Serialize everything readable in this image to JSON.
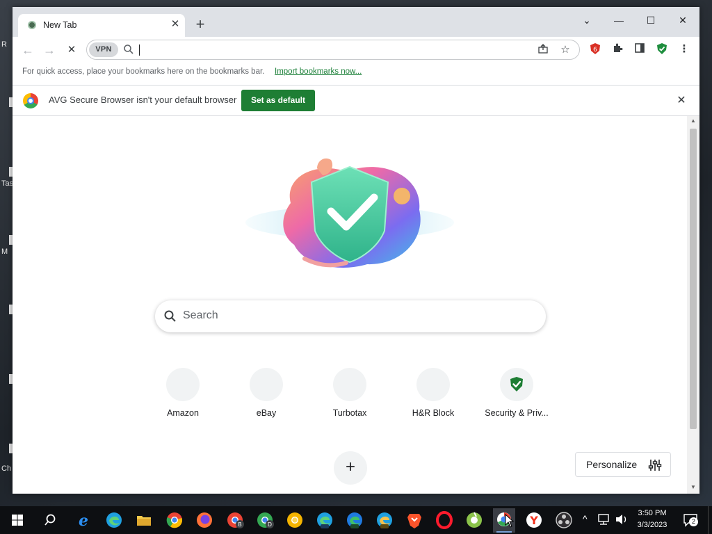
{
  "desktop": {
    "labels": [
      "R",
      "Tas",
      "M",
      "Ch"
    ]
  },
  "browser": {
    "tab": {
      "title": "New Tab",
      "close": "✕"
    },
    "new_tab": "+",
    "window_controls": {
      "minimize": "—",
      "maximize": "☐",
      "close": "✕",
      "dropdown": "⌄"
    },
    "toolbar": {
      "back": "←",
      "forward": "→",
      "reload": "✕",
      "vpn_label": "VPN",
      "address_value": ""
    },
    "bookmarks_bar": {
      "text": "For quick access, place your bookmarks here on the bookmarks bar.",
      "import_link": "Import bookmarks now..."
    },
    "infobar": {
      "message": "AVG Secure Browser isn't your default browser",
      "button": "Set as default",
      "close": "✕"
    },
    "new_tab_page": {
      "search_placeholder": "Search",
      "shortcuts": [
        {
          "label": "Amazon",
          "icon": "blank"
        },
        {
          "label": "eBay",
          "icon": "blank"
        },
        {
          "label": "Turbotax",
          "icon": "blank"
        },
        {
          "label": "H&R Block",
          "icon": "blank"
        },
        {
          "label": "Security & Priv...",
          "icon": "shield-check"
        }
      ],
      "add_shortcut": "+",
      "personalize": "Personalize"
    }
  },
  "taskbar": {
    "clock_time": "3:50 PM",
    "clock_date": "3/3/2023",
    "notifications_count": "2",
    "apps": [
      "start",
      "search",
      "internet-explorer",
      "edge",
      "file-explorer",
      "chrome",
      "firefox",
      "chrome-beta",
      "chrome-dev",
      "chrome-canary",
      "edge-beta",
      "edge-dev",
      "edge-canary",
      "brave",
      "opera",
      "avg-secure",
      "avast-secure",
      "yandex",
      "obs"
    ]
  },
  "colors": {
    "accent_green": "#1e7e34",
    "link_green": "#1a7f37",
    "tab_strip": "#dee1e6"
  }
}
